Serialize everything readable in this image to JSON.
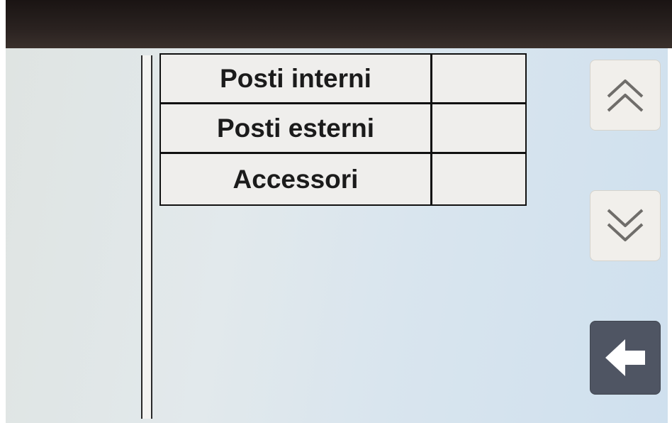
{
  "menu": {
    "items": [
      {
        "label": "Posti interni"
      },
      {
        "label": "Posti esterni"
      },
      {
        "label": "Accessori"
      }
    ]
  },
  "controls": {
    "scroll_up_icon": "double-chevron-up-icon",
    "scroll_down_icon": "double-chevron-down-icon",
    "back_icon": "arrow-left-icon"
  },
  "colors": {
    "screen_background": "#dce6ec",
    "menu_background": "#efeeec",
    "back_button": "#4f5563"
  }
}
